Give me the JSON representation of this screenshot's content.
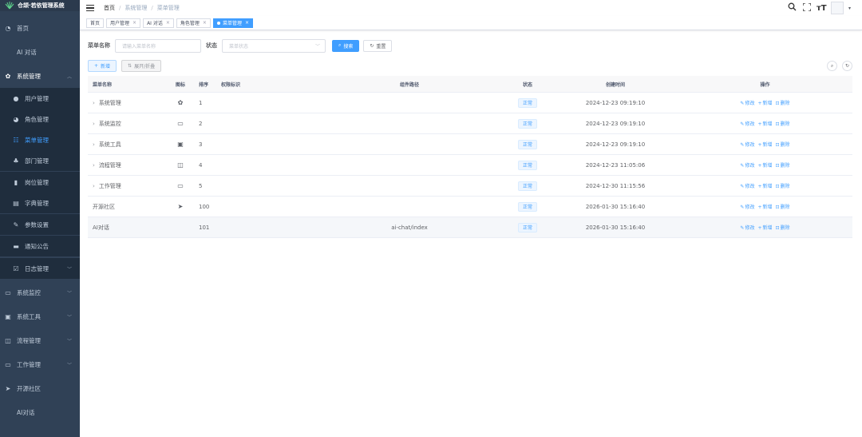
{
  "app": {
    "logo_text": "仓颉·若依管理系统"
  },
  "sidebar": {
    "items": [
      {
        "label": "首页",
        "icon": "dashboard-icon"
      },
      {
        "label": "AI 对话"
      },
      {
        "label": "系统管理",
        "icon": "gear-icon"
      },
      {
        "label": "用户管理",
        "icon": "user-icon"
      },
      {
        "label": "角色管理",
        "icon": "peoples-icon"
      },
      {
        "label": "菜单管理",
        "icon": "tree-table-icon"
      },
      {
        "label": "部门管理",
        "icon": "tree-icon"
      },
      {
        "label": "岗位管理",
        "icon": "post-icon"
      },
      {
        "label": "字典管理",
        "icon": "dict-icon"
      },
      {
        "label": "参数设置",
        "icon": "edit-icon"
      },
      {
        "label": "通知公告",
        "icon": "message-icon"
      },
      {
        "label": "日志管理",
        "icon": "log-icon"
      },
      {
        "label": "系统监控",
        "icon": "monitor-icon"
      },
      {
        "label": "系统工具",
        "icon": "tool-icon"
      },
      {
        "label": "流程管理",
        "icon": "flow-icon"
      },
      {
        "label": "工作管理",
        "icon": "work-icon"
      },
      {
        "label": "开源社区",
        "icon": "send-icon"
      },
      {
        "label": "AI对话"
      }
    ]
  },
  "header": {
    "breadcrumb": [
      "首页",
      "系统管理",
      "菜单管理"
    ]
  },
  "tags": [
    {
      "label": "首页"
    },
    {
      "label": "用户管理"
    },
    {
      "label": "AI 对话"
    },
    {
      "label": "角色管理"
    },
    {
      "label": "菜单管理",
      "active": true
    }
  ],
  "search": {
    "name_label": "菜单名称",
    "name_placeholder": "请输入菜单名称",
    "status_label": "状态",
    "status_placeholder": "菜单状态",
    "search_btn": "搜索",
    "reset_btn": "重置"
  },
  "toolbar": {
    "add_btn": "新增",
    "expand_btn": "展开/折叠"
  },
  "table": {
    "columns": [
      "菜单名称",
      "图标",
      "排序",
      "权限标识",
      "组件路径",
      "状态",
      "创建时间",
      "操作"
    ],
    "rows": [
      {
        "name": "系统管理",
        "expandable": true,
        "icon": "gear-icon",
        "sort": "1",
        "perm": "",
        "path": "",
        "status": "正常",
        "time": "2024-12-23 09:19:10"
      },
      {
        "name": "系统监控",
        "expandable": true,
        "icon": "monitor-icon",
        "sort": "2",
        "perm": "",
        "path": "",
        "status": "正常",
        "time": "2024-12-23 09:19:10"
      },
      {
        "name": "系统工具",
        "expandable": true,
        "icon": "tool-icon",
        "sort": "3",
        "perm": "",
        "path": "",
        "status": "正常",
        "time": "2024-12-23 09:19:10"
      },
      {
        "name": "流程管理",
        "expandable": true,
        "icon": "flow-icon",
        "sort": "4",
        "perm": "",
        "path": "",
        "status": "正常",
        "time": "2024-12-23 11:05:06"
      },
      {
        "name": "工作管理",
        "expandable": true,
        "icon": "work-icon",
        "sort": "5",
        "perm": "",
        "path": "",
        "status": "正常",
        "time": "2024-12-30 11:15:56"
      },
      {
        "name": "开源社区",
        "expandable": false,
        "icon": "send-icon",
        "sort": "100",
        "perm": "",
        "path": "",
        "status": "正常",
        "time": "2026-01-30 15:16:40"
      },
      {
        "name": "AI对话",
        "expandable": false,
        "icon": "",
        "sort": "101",
        "perm": "",
        "path": "ai-chat/index",
        "status": "正常",
        "time": "2026-01-30 15:16:40"
      }
    ],
    "ops": {
      "edit": "修改",
      "add": "新增",
      "delete": "删除"
    }
  },
  "colors": {
    "sidebar_bg": "#304156",
    "accent": "#409eff"
  }
}
